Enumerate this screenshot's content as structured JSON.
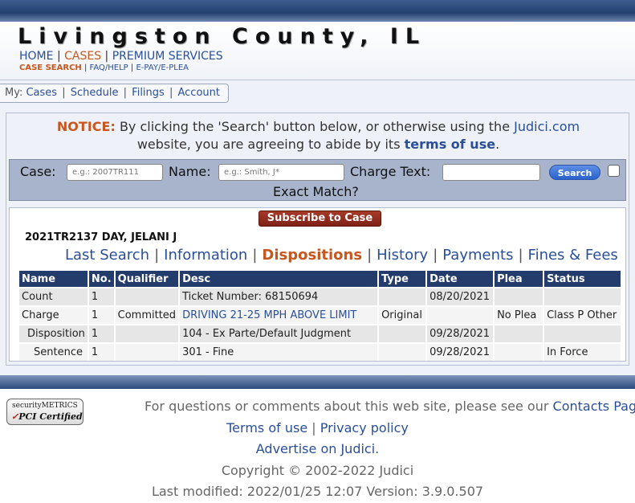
{
  "site": {
    "title": "Livingston County, IL",
    "nav_primary": [
      "HOME",
      "CASES",
      "PREMIUM SERVICES"
    ],
    "nav_secondary": [
      "CASE SEARCH",
      "FAQ/HELP",
      "E-PAY/E-PLEA"
    ]
  },
  "my_bar": {
    "prefix": "My:",
    "links": [
      "Cases",
      "Schedule",
      "Filings",
      "Account"
    ]
  },
  "notice": {
    "label": "NOTICE:",
    "text_before": "By clicking the 'Search' button below, or otherwise using the",
    "site_link": "Judici.com",
    "text_middle": "website, you are agreeing to abide by its",
    "terms_link": "terms of use",
    "text_after": "."
  },
  "search": {
    "case_label": "Case:",
    "case_placeholder": "e.g.: 2007TR111",
    "name_label": "Name:",
    "name_placeholder": "e.g.: Smith, J*",
    "charge_label": "Charge Text:",
    "charge_placeholder": "",
    "button": "Search",
    "exact_match": "Exact Match?"
  },
  "case": {
    "subscribe_button": "Subscribe to Case",
    "id_line": "2021TR2137  DAY, JELANI J",
    "tabs": [
      "Last Search",
      "Information",
      "Dispositions",
      "History",
      "Payments",
      "Fines & Fees"
    ],
    "active_tab": "Dispositions"
  },
  "dispositions": {
    "columns": [
      "Name",
      "No.",
      "Qualifier",
      "Desc",
      "Type",
      "Date",
      "Plea",
      "Status"
    ],
    "rows": [
      [
        "Count",
        "1",
        "",
        "Ticket Number: 68150694",
        "",
        "08/20/2021",
        "",
        ""
      ],
      [
        "Charge",
        "1",
        "Committed",
        "DRIVING 21-25 MPH ABOVE LIMIT",
        "Original",
        "",
        "No Plea",
        "Class P Other"
      ],
      [
        "Disposition",
        "1",
        "",
        "104 - Ex Parte/Default Judgment",
        "",
        "09/28/2021",
        "",
        ""
      ],
      [
        "Sentence",
        "1",
        "",
        "301 - Fine",
        "",
        "09/28/2021",
        "",
        "In Force"
      ]
    ]
  },
  "footer": {
    "badge_line1": "securityMETRICS",
    "badge_line2": "PCI Certified",
    "questions_text": "For questions or comments about this web site, please see our",
    "contacts_link": "Contacts Page",
    "terms_link": "Terms of use",
    "privacy_link": "Privacy policy",
    "advertise": "Advertise on Judici.",
    "copyright": "Copyright © 2002-2022 Judici",
    "modified": "Last modified: 2022/01/25 12:07 Version: 3.9.0.507"
  }
}
